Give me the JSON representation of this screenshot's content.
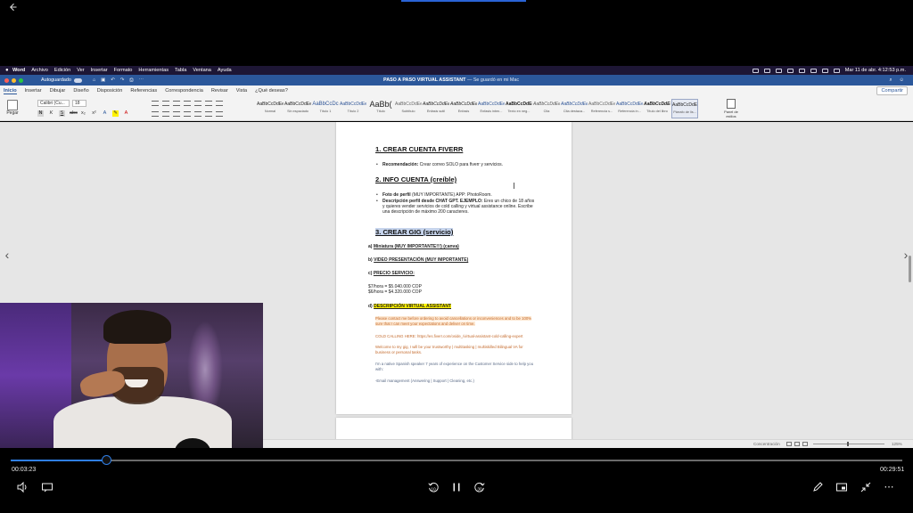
{
  "mac_menu": {
    "app": "Word",
    "items": [
      "Archivo",
      "Edición",
      "Ver",
      "Insertar",
      "Formato",
      "Herramientas",
      "Tabla",
      "Ventana",
      "Ayuda"
    ],
    "clock": "Mar 11 de abr.  4:12:53 p.m."
  },
  "word": {
    "autosave_label": "Autoguardado",
    "doc_title": "PASO A PASO VIRTUAL ASSISTANT",
    "saved_status": "— Se guardó en mi Mac",
    "share_label": "Compartir",
    "tabs": [
      "Inicio",
      "Insertar",
      "Dibujar",
      "Diseño",
      "Disposición",
      "Referencias",
      "Correspondencia",
      "Revisar",
      "Vista",
      "¿Qué deseas?"
    ],
    "paste_label": "Pegar",
    "font_name": "Calibri (Cu...",
    "font_size": "18",
    "styles": [
      {
        "preview": "AaBbCcDdEe",
        "label": "Normal"
      },
      {
        "preview": "AaBbCcDdEe",
        "label": "Sin espaciado"
      },
      {
        "preview": "AaBbCcDc",
        "label": "Título 1"
      },
      {
        "preview": "AaBbCcDdEe",
        "label": "Título 2"
      },
      {
        "preview": "AaBb(",
        "label": "Título"
      },
      {
        "preview": "AaBbCcDdEe",
        "label": "Subtítulo"
      },
      {
        "preview": "AaBbCcDdEe",
        "label": "Énfasis sutil"
      },
      {
        "preview": "AaBbCcDdEe",
        "label": "Énfasis"
      },
      {
        "preview": "AaBbCcDdEe",
        "label": "Énfasis inten..."
      },
      {
        "preview": "AaBbCcDdEe",
        "label": "Texto en neg..."
      },
      {
        "preview": "AaBbCcDdEe",
        "label": "Cita"
      },
      {
        "preview": "AaBbCcDdEe",
        "label": "Cita destaca..."
      },
      {
        "preview": "AaBbCcDdEe",
        "label": "Referencia s..."
      },
      {
        "preview": "AaBbCcDdEe",
        "label": "Referencia in..."
      },
      {
        "preview": "AaBbCcDdEe",
        "label": "Título del libro"
      },
      {
        "preview": "AaBbCcDdEe",
        "label": "Párrafo de lis..."
      }
    ],
    "styles_panel": "Panel de estilos",
    "status": {
      "focus": "Concentración",
      "zoom": "125%"
    }
  },
  "document": {
    "h1": "1. CREAR CUENTA FIVERR",
    "b1_bold": "Recomendación:",
    "b1_text": " Crear correo SOLO para fiverr y servicios.",
    "h2": "2. INFO CUENTA (creíble)",
    "b2_bold": "Foto de perfil",
    "b2_text": " (MUY IMPORTANTE) APP: PhotoRoom.",
    "b3_bold": "Descripción perfil desde CHAT GPT. EJEMPLO:",
    "b3_text": " Eres un chico de 18 años y quieres vender servicios de cold calling y virtual assistance online. Escribe una descripción de máximo 200 caracteres.",
    "h3": "3. CREAR GIG (servicio)",
    "sub_a_letter": "a)",
    "sub_a": "Miniatura (MUY IMPORTANTE!!!) (canva)",
    "sub_b_letter": "b)",
    "sub_b": "VIDEO PRESENTACIÓN (MUY IMPORTANTE)",
    "sub_c_letter": "c)",
    "sub_c": "PRECIO SERVICIO:",
    "price1": "$7/hora = $5.040.000 COP",
    "price2": "$6/hora = $4.320.000 COP",
    "sub_d_letter": "d)",
    "sub_d": "DESCRIPCIÓN VIRTUAL ASSISTANT",
    "orange1": "Please contact me before ordering to avoid cancellations or inconveniences and to be 100% sure that I can meet your expectations and deliver on time.",
    "orange2": "COLD CALLING HERE: https://es.fiverr.com/oside_/virtual-assistant-cold-calling-expert",
    "orange3": "Welcome to my gig, I will be your trustworthy | multitasking | multiskilled Bilingual VA for business or personal tasks.",
    "grey1": "I'm a native Spanish speaker 7 years of experience on the Customer Service side to help you with:",
    "grey2": "-Email management (Answering | Support | Cleaning, etc.)"
  },
  "player": {
    "current_time": "00:03:23",
    "total_time": "00:29:51",
    "progress": 0.107,
    "skip_back_label": "10",
    "skip_fwd_label": "30"
  }
}
